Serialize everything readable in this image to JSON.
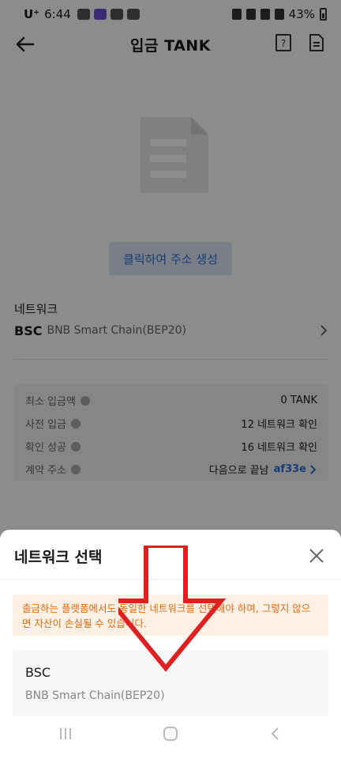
{
  "status_bar": {
    "carrier": "U⁺",
    "time": "6:44",
    "battery": "43%"
  },
  "header": {
    "title": "입금 TANK",
    "back_icon": "back-arrow-icon",
    "help_icon": "help-icon",
    "doc_icon": "document-icon"
  },
  "generate_button": "클릭하여 주소 생성",
  "network": {
    "label": "네트워크",
    "code": "BSC",
    "name": "BNB Smart Chain(BEP20)"
  },
  "info": {
    "rows": [
      {
        "label": "최소 입금액",
        "value": "0 TANK"
      },
      {
        "label": "사전 입금",
        "value": "12 네트워크 확인"
      },
      {
        "label": "확인 성공",
        "value": "16 네트워크 확인"
      },
      {
        "label": "계약 주소",
        "value": "다음으로 끝남",
        "link": "af33e"
      }
    ]
  },
  "sheet": {
    "title": "네트워크 선택",
    "warning": "출금하는 플랫폼에서도 동일한 네트워크를 선택해야 하며, 그렇지 않으면 자산이 손실될 수 있습니다.",
    "option": {
      "code": "BSC",
      "name": "BNB Smart Chain(BEP20)"
    }
  },
  "colors": {
    "accent": "#2b6dd8",
    "warning_text": "#e36a12",
    "warning_bg": "#fdf1e6",
    "annotation_arrow": "#e02020"
  }
}
